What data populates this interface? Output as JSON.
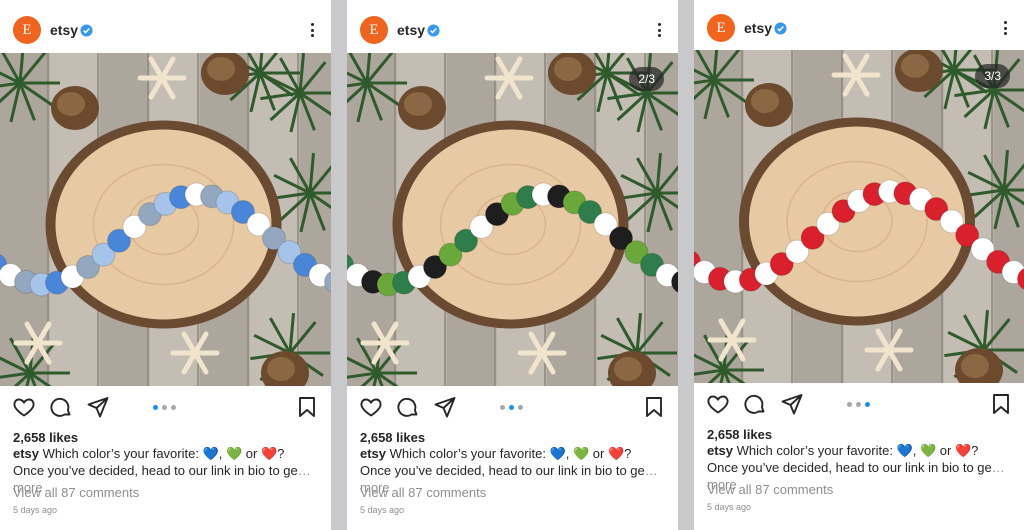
{
  "posts": [
    {
      "account": {
        "avatar_letter": "E",
        "username": "etsy",
        "verified": true,
        "avatar_color": "#f1641e"
      },
      "image": {
        "description_icon": "felt-ball-garland-photo",
        "garland_colors": [
          "#4a86d8",
          "#ffffff",
          "#93a8bf",
          "#a6c4ea"
        ]
      },
      "carousel": {
        "counter": "",
        "active_dot": 0
      },
      "likes": "2,658 likes",
      "caption": {
        "user": "etsy",
        "text_a": "Which color’s your favorite: 💙, 💚 or ❤️? Once you’ve decided, head to our link in bio to ge",
        "more": "… more"
      },
      "view_comments": "View all 87 comments",
      "time": "5 days ago"
    },
    {
      "account": {
        "avatar_letter": "E",
        "username": "etsy",
        "verified": true,
        "avatar_color": "#f1641e"
      },
      "image": {
        "description_icon": "felt-ball-garland-photo",
        "garland_colors": [
          "#2e7d4a",
          "#ffffff",
          "#1e1e1e",
          "#6ba83c"
        ]
      },
      "carousel": {
        "counter": "2/3",
        "active_dot": 1
      },
      "likes": "2,658 likes",
      "caption": {
        "user": "etsy",
        "text_a": "Which color’s your favorite: 💙, 💚 or ❤️? Once you’ve decided, head to our link in bio to ge",
        "more": "… more"
      },
      "view_comments": "View all 87 comments",
      "time": "5 days ago"
    },
    {
      "account": {
        "avatar_letter": "E",
        "username": "etsy",
        "verified": true,
        "avatar_color": "#f1641e"
      },
      "image": {
        "description_icon": "felt-ball-garland-photo",
        "garland_colors": [
          "#d9202c",
          "#ffffff",
          "#d9202c",
          "#ffffff"
        ]
      },
      "carousel": {
        "counter": "3/3",
        "active_dot": 2
      },
      "likes": "2,658 likes",
      "caption": {
        "user": "etsy",
        "text_a": "Which color’s your favorite: 💙, 💚 or ❤️? Once you’ve decided, head to our link in bio to ge",
        "more": "… more"
      },
      "view_comments": "View all 87 comments",
      "time": "5 days ago"
    }
  ],
  "icons": {
    "like": "heart-icon",
    "comment": "comment-bubble-icon",
    "share": "paper-plane-icon",
    "save": "bookmark-icon",
    "menu": "three-dots-vertical-icon",
    "verified": "verified-badge-icon"
  },
  "colors": {
    "verified_blue": "#3897f0",
    "active_dot": "#1c8ef0",
    "muted_text": "#8e8e8e",
    "text": "#262626"
  }
}
